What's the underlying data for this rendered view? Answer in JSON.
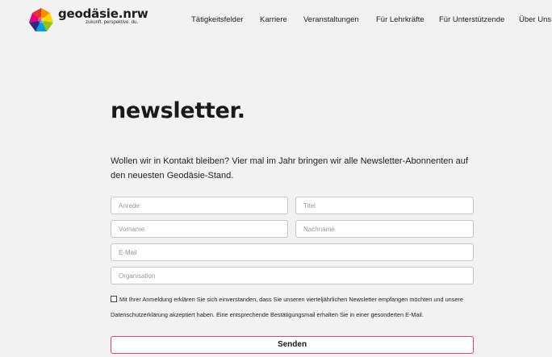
{
  "brand": {
    "name": "geodäsie.nrw",
    "tagline": "zukunft. perspektive. du."
  },
  "nav": {
    "items": [
      {
        "label": "Tätigkeitsfelder"
      },
      {
        "label": "Karriere"
      },
      {
        "label": "Veranstaltungen"
      },
      {
        "label": "Für Lehrkräfte"
      },
      {
        "label": "Für Unterstützende"
      },
      {
        "label": "Über Uns"
      }
    ]
  },
  "newsletter": {
    "title": "newsletter.",
    "intro": "Wollen wir in Kontakt bleiben? Vier mal im Jahr bringen wir alle Newsletter-Abonnenten auf den neuesten Geodäsie-Stand.",
    "fields": {
      "anrede": "Anrede",
      "titel": "Titel",
      "vorname": "Vorname",
      "nachname": "Nachname",
      "email": "E-Mail",
      "organisation": "Organisation"
    },
    "consent": "Mit Ihrer Anmeldung erklären Sie sich einverstanden, dass Sie unseren vierteljährlichen Newsletter empfangen möchten und unsere Datenschutzerklärung akzeptiert haben. Eine entsprechende Bestätigungsmail erhalten Sie in einer gesonderten E-Mail.",
    "submit": "Senden"
  },
  "colors": {
    "background": "#f2f2f2",
    "button_border": "#d4407c",
    "logo": [
      "#e4007c",
      "#f39200",
      "#ffd500",
      "#95c11f",
      "#009fe3",
      "#312783"
    ]
  },
  "icons": {
    "logo": "multicolor-polyhedron-icon",
    "checkbox": "checkbox-unchecked"
  }
}
